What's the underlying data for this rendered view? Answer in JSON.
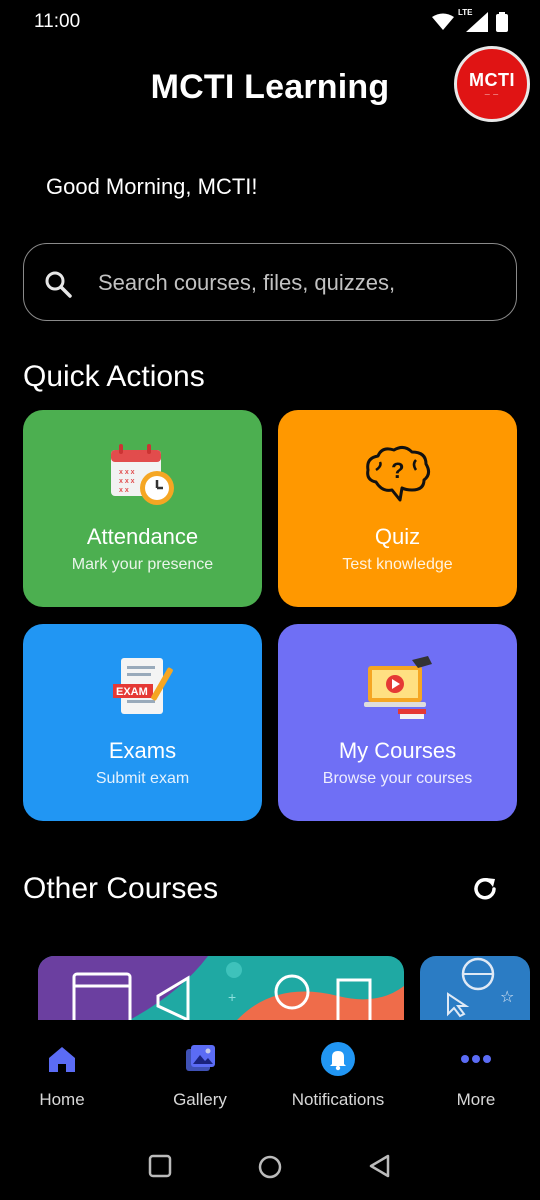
{
  "status": {
    "time": "11:00",
    "network": "LTE"
  },
  "app": {
    "title": "MCTI Learning",
    "logo_text": "MCTI"
  },
  "greeting": "Good Morning, MCTI!",
  "search": {
    "placeholder": "Search courses, files, quizzes,"
  },
  "quick_actions": {
    "title": "Quick Actions",
    "cards": [
      {
        "title": "Attendance",
        "subtitle": "Mark your presence",
        "color": "#4CAF50",
        "icon": "calendar-clock-icon"
      },
      {
        "title": "Quiz",
        "subtitle": "Test knowledge",
        "color": "#FF9800",
        "icon": "brain-question-icon"
      },
      {
        "title": "Exams",
        "subtitle": "Submit exam",
        "color": "#2196F3",
        "icon": "exam-paper-icon"
      },
      {
        "title": "My Courses",
        "subtitle": "Browse your courses",
        "color": "#6F6FF5",
        "icon": "online-course-icon"
      }
    ]
  },
  "other_courses": {
    "title": "Other Courses"
  },
  "bottom_nav": [
    {
      "label": "Home",
      "icon": "home-icon",
      "active": true
    },
    {
      "label": "Gallery",
      "icon": "gallery-icon"
    },
    {
      "label": "Notifications",
      "icon": "bell-icon"
    },
    {
      "label": "More",
      "icon": "more-dots-icon"
    }
  ],
  "colors": {
    "accent": "#5B6CF5",
    "notification": "#2196F3"
  }
}
